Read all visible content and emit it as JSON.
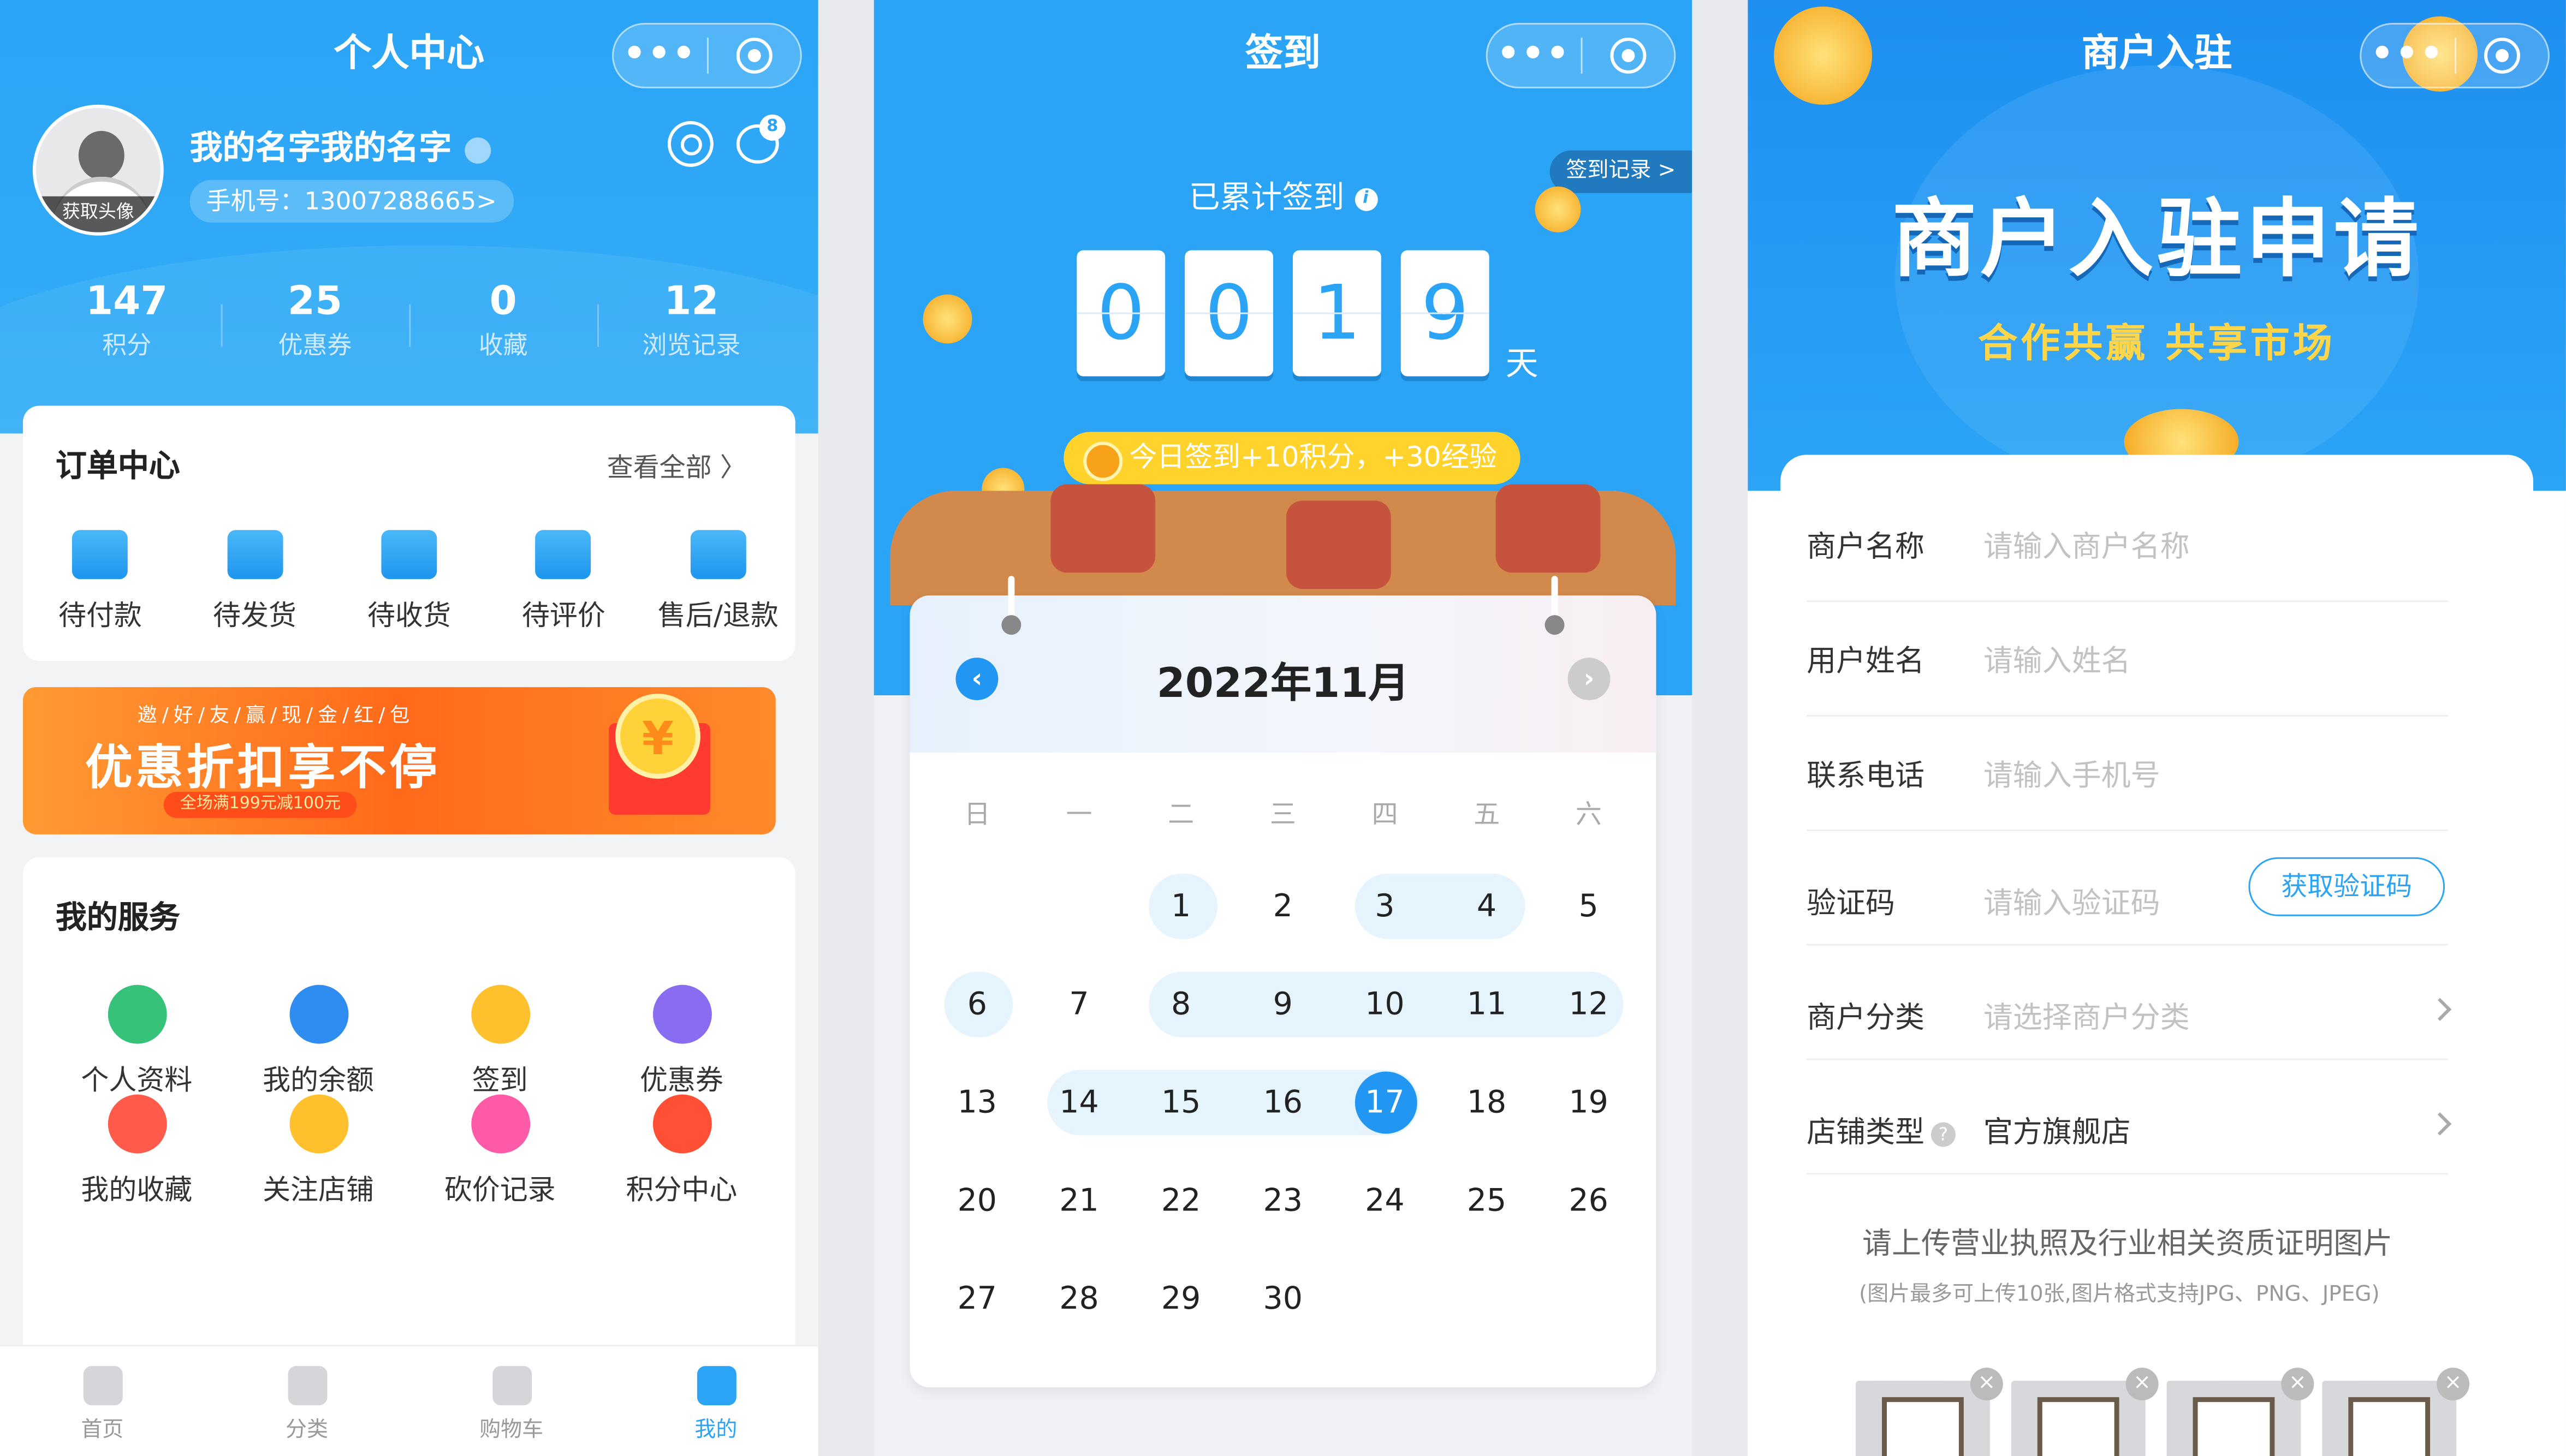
{
  "profile": {
    "title": "个人中心",
    "avatar_label": "获取头像",
    "name": "我的名字我的名字",
    "phone": "手机号：13007288665>",
    "msg_count": "8",
    "stats": [
      {
        "num": "147",
        "label": "积分"
      },
      {
        "num": "25",
        "label": "优惠券"
      },
      {
        "num": "0",
        "label": "收藏"
      },
      {
        "num": "12",
        "label": "浏览记录"
      }
    ],
    "orders": {
      "title": "订单中心",
      "more": "查看全部 〉",
      "items": [
        "待付款",
        "待发货",
        "待收货",
        "待评价",
        "售后/退款"
      ]
    },
    "banner": {
      "small": "邀/好/友/赢/现/金/红/包",
      "big": "优惠折扣享不停",
      "cond": "全场满199元减100元",
      "coin": "¥"
    },
    "services": {
      "title": "我的服务",
      "items": [
        {
          "label": "个人资料",
          "color": "#37c27a"
        },
        {
          "label": "我的余额",
          "color": "#2f8cf0"
        },
        {
          "label": "签到",
          "color": "#ffc02e"
        },
        {
          "label": "优惠券",
          "color": "#8a6cf0"
        },
        {
          "label": "我的收藏",
          "color": "#ff5a4a"
        },
        {
          "label": "关注店铺",
          "color": "#ffc02e"
        },
        {
          "label": "砍价记录",
          "color": "#ff5aa8"
        },
        {
          "label": "积分中心",
          "color": "#ff5035"
        }
      ]
    },
    "tabbar": [
      "首页",
      "分类",
      "购物车",
      "我的"
    ]
  },
  "checkin": {
    "title": "签到",
    "records": "签到记录 >",
    "accum": "已累计签到",
    "info": "i",
    "digits": [
      "0",
      "0",
      "1",
      "9"
    ],
    "unit": "天",
    "today": "今日签到+10积分，+30经验",
    "month": "2022年11月",
    "nav_prev": "‹",
    "nav_next": "›",
    "weekdays": [
      "日",
      "一",
      "二",
      "三",
      "四",
      "五",
      "六"
    ],
    "days": [
      "",
      "",
      "1",
      "2",
      "3",
      "4",
      "5",
      "6",
      "7",
      "8",
      "9",
      "10",
      "11",
      "12",
      "13",
      "14",
      "15",
      "16",
      "17",
      "18",
      "19",
      "20",
      "21",
      "22",
      "23",
      "24",
      "25",
      "26",
      "27",
      "28",
      "29",
      "30"
    ],
    "selected_day": "17"
  },
  "merchant": {
    "title": "商户入驻",
    "banner_title": "商户入驻申请",
    "banner_sub": "合作共赢 共享市场",
    "fields": [
      {
        "label": "商户名称",
        "value": "请输入商户名称"
      },
      {
        "label": "用户姓名",
        "value": "请输入姓名"
      },
      {
        "label": "联系电话",
        "value": "请输入手机号"
      },
      {
        "label": "验证码",
        "value": "请输入验证码"
      },
      {
        "label": "商户分类",
        "value": "请选择商户分类"
      },
      {
        "label": "店铺类型",
        "value": "官方旗舰店"
      }
    ],
    "code_btn": "获取验证码",
    "help": "?",
    "upload_note": "请上传营业执照及行业相关资质证明图片",
    "upload_limit": "(图片最多可上传10张,图片格式支持JPG、PNG、JPEG)",
    "remove": "×"
  }
}
